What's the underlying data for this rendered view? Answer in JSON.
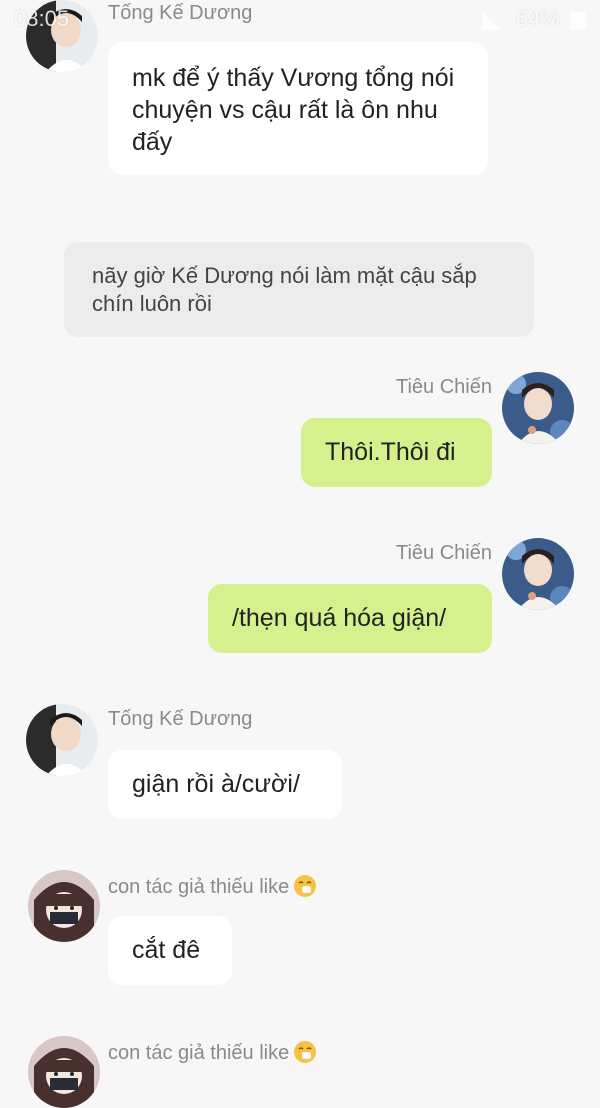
{
  "status_bar": {
    "time": "08:05",
    "battery": "64%"
  },
  "messages": [
    {
      "sender": "Tống Kế Dương",
      "text": "mk để ý thấy Vương tổng nói chuyện vs cậu rất là ôn nhu đấy",
      "side": "left"
    },
    {
      "narration": "nãy giờ Kế Dương nói làm mặt cậu sắp chín luôn rồi"
    },
    {
      "sender": "Tiêu Chiến",
      "text": "Thôi.Thôi đi",
      "side": "right"
    },
    {
      "sender": "Tiêu Chiến",
      "text": "/thẹn quá hóa giận/",
      "side": "right"
    },
    {
      "sender": "Tống Kế Dương",
      "text": "giận rồi à/cười/",
      "side": "left"
    },
    {
      "sender": "con tác giả thiếu like",
      "text": "cắt đê",
      "side": "left",
      "emoji": "sneezing-face-emoji"
    },
    {
      "sender": "con tác giả thiếu like",
      "side": "left",
      "emoji": "sneezing-face-emoji"
    }
  ],
  "colors": {
    "background": "#f7f7f7",
    "left_bubble": "#ffffff",
    "right_bubble": "#d4f18d",
    "narration_bubble": "#ececec",
    "name_text": "#8a8a8a"
  }
}
